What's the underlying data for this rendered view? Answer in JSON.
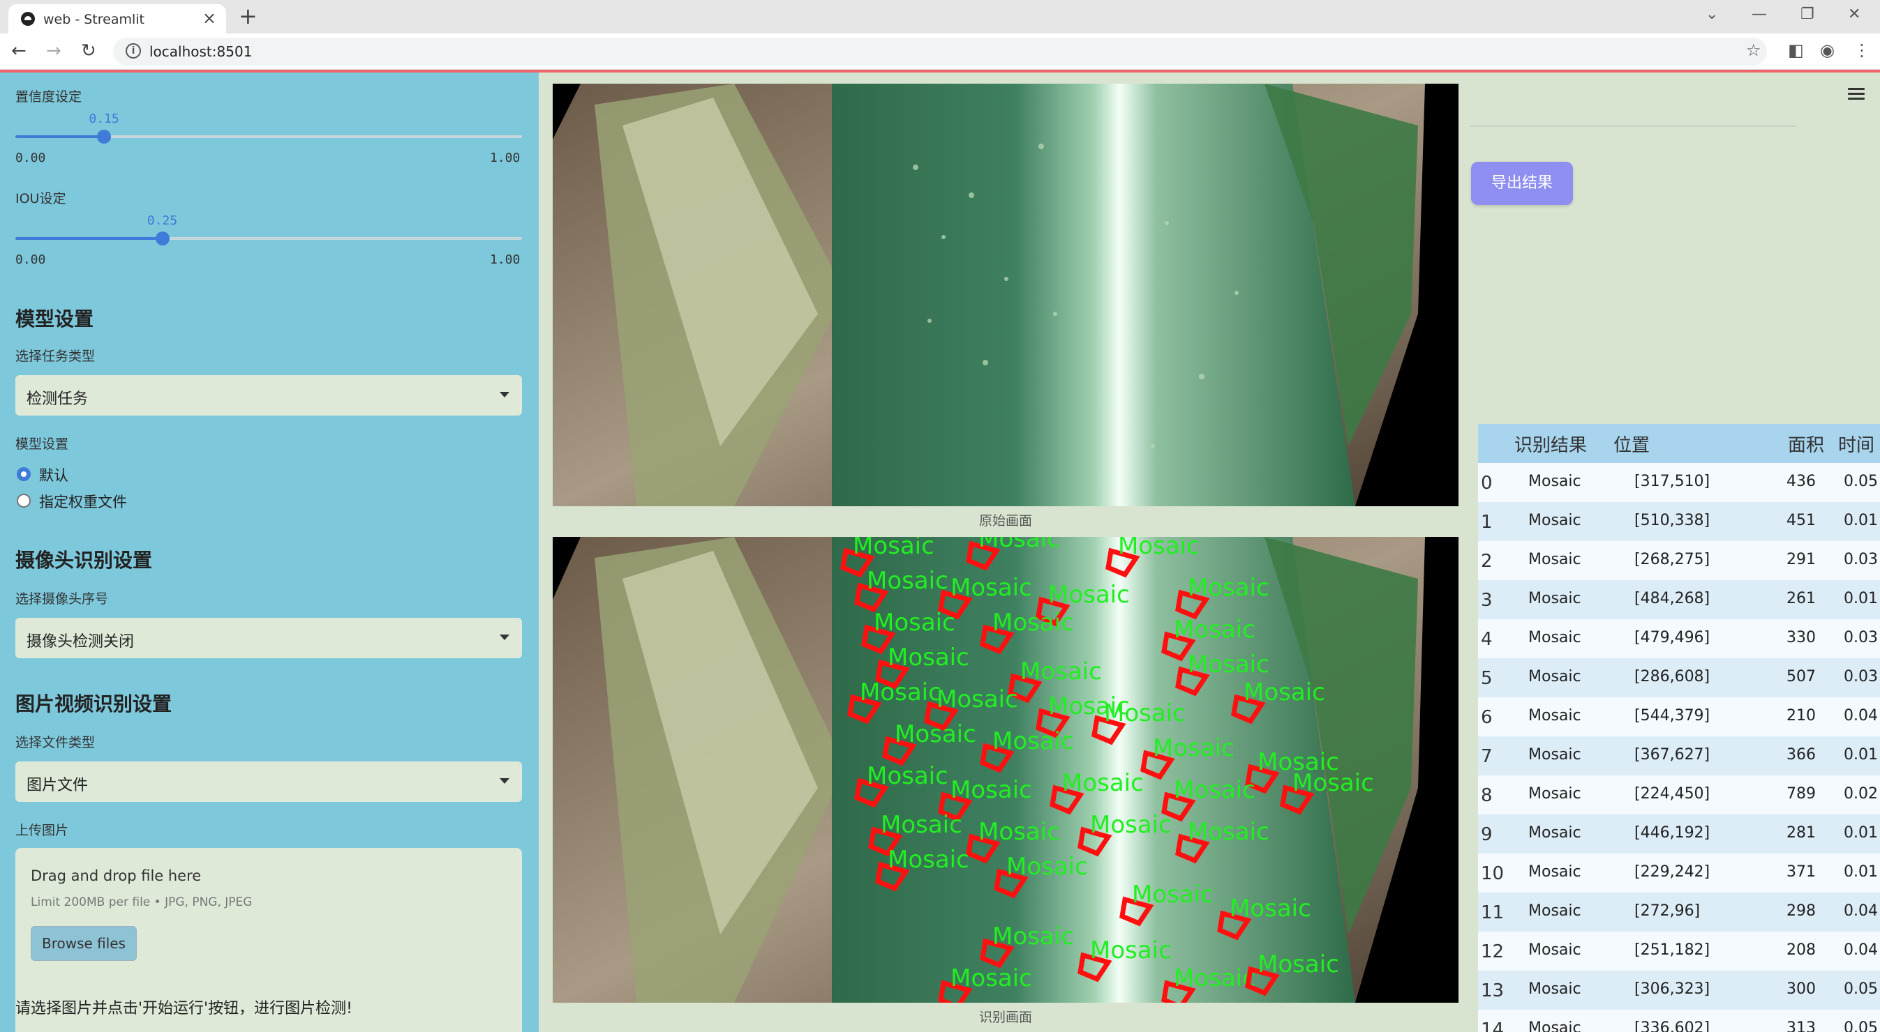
{
  "browser": {
    "tab_title": "web - Streamlit",
    "url": "localhost:8501"
  },
  "sidebar": {
    "confidence_label": "置信度设定",
    "confidence": {
      "value": "0.15",
      "min": "0.00",
      "max": "1.00",
      "level": 0.15
    },
    "iou_label": "IOU设定",
    "iou": {
      "value": "0.25",
      "min": "0.00",
      "max": "1.00",
      "level": 0.25
    },
    "model_header": "模型设置",
    "task_type_label": "选择任务类型",
    "task_type_value": "检测任务",
    "model_settings_label": "模型设置",
    "model_options": [
      "默认",
      "指定权重文件"
    ],
    "model_selected": "默认",
    "camera_header": "摄像头识别设置",
    "camera_label": "选择摄像头序号",
    "camera_value": "摄像头检测关闭",
    "media_header": "图片视频识别设置",
    "file_type_label": "选择文件类型",
    "file_type_value": "图片文件",
    "upload_label": "上传图片",
    "upload_title": "Drag and drop file here",
    "upload_limit": "Limit 200MB per file • JPG, PNG, JPEG",
    "browse_label": "Browse files",
    "note": "请选择图片并点击'开始运行'按钮，进行图片检测!"
  },
  "main": {
    "original_caption": "原始画面",
    "detected_caption": "识别画面",
    "detection_tag": "Mosaic"
  },
  "right": {
    "export_label": "导出结果",
    "table_headers": [
      "识别结果",
      "位置",
      "面积",
      "时间"
    ],
    "rows": [
      {
        "idx": "0",
        "label": "Mosaic",
        "pos": "[317,510]",
        "area": "436",
        "time": "0.05"
      },
      {
        "idx": "1",
        "label": "Mosaic",
        "pos": "[510,338]",
        "area": "451",
        "time": "0.01"
      },
      {
        "idx": "2",
        "label": "Mosaic",
        "pos": "[268,275]",
        "area": "291",
        "time": "0.03"
      },
      {
        "idx": "3",
        "label": "Mosaic",
        "pos": "[484,268]",
        "area": "261",
        "time": "0.01"
      },
      {
        "idx": "4",
        "label": "Mosaic",
        "pos": "[479,496]",
        "area": "330",
        "time": "0.03"
      },
      {
        "idx": "5",
        "label": "Mosaic",
        "pos": "[286,608]",
        "area": "507",
        "time": "0.03"
      },
      {
        "idx": "6",
        "label": "Mosaic",
        "pos": "[544,379]",
        "area": "210",
        "time": "0.04"
      },
      {
        "idx": "7",
        "label": "Mosaic",
        "pos": "[367,627]",
        "area": "366",
        "time": "0.01"
      },
      {
        "idx": "8",
        "label": "Mosaic",
        "pos": "[224,450]",
        "area": "789",
        "time": "0.02"
      },
      {
        "idx": "9",
        "label": "Mosaic",
        "pos": "[446,192]",
        "area": "281",
        "time": "0.01"
      },
      {
        "idx": "10",
        "label": "Mosaic",
        "pos": "[229,242]",
        "area": "371",
        "time": "0.01"
      },
      {
        "idx": "11",
        "label": "Mosaic",
        "pos": "[272,96]",
        "area": "298",
        "time": "0.04"
      },
      {
        "idx": "12",
        "label": "Mosaic",
        "pos": "[251,182]",
        "area": "208",
        "time": "0.04"
      },
      {
        "idx": "13",
        "label": "Mosaic",
        "pos": "[306,323]",
        "area": "300",
        "time": "0.05"
      },
      {
        "idx": "14",
        "label": "Mosaic",
        "pos": "[336,602]",
        "area": "313",
        "time": "0.05"
      }
    ]
  },
  "colors": {
    "sidebar_bg": "#7ec8dc",
    "accent": "#3f7bd8",
    "export_button": "#8e8ff0",
    "detection_box": "#ff1010",
    "detection_text": "#22ee22"
  }
}
